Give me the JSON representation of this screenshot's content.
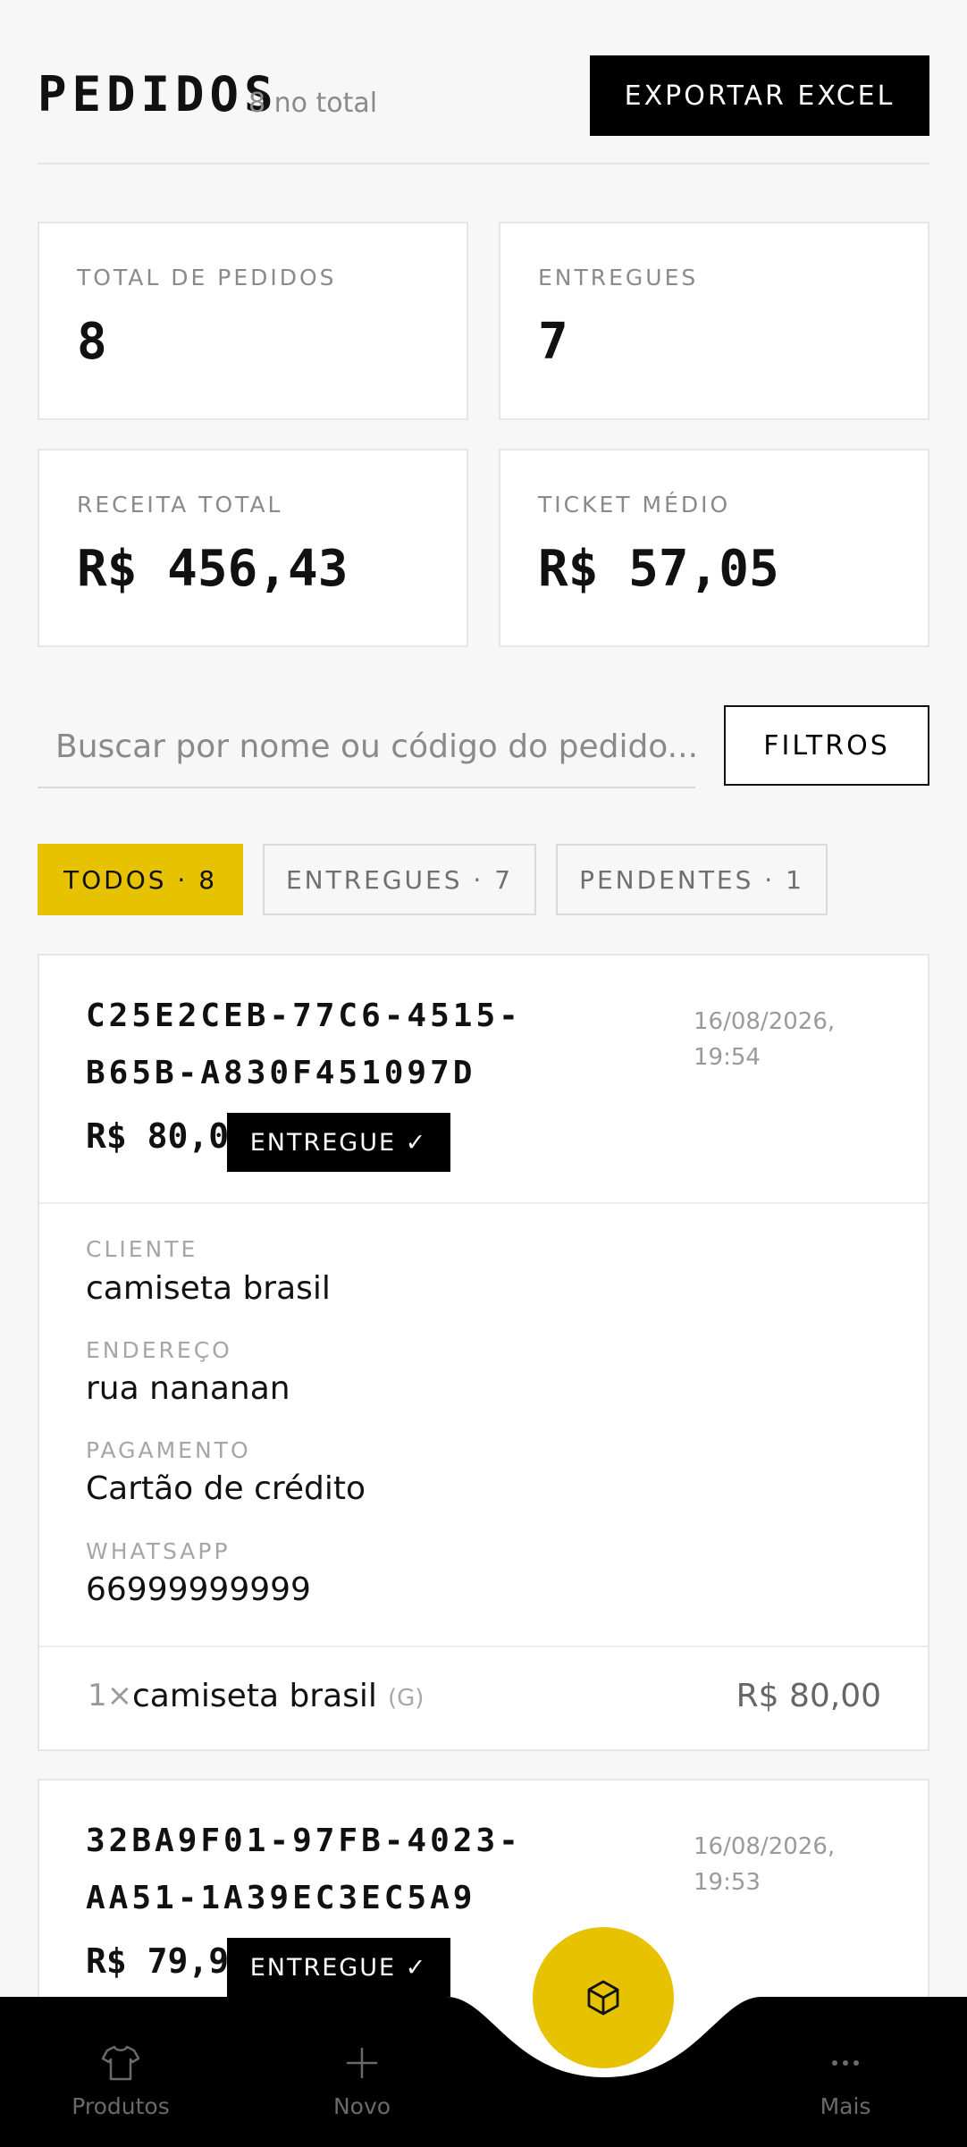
{
  "header": {
    "title": "PEDIDOS",
    "subtitle": "8 no total",
    "export_label": "EXPORTAR EXCEL"
  },
  "stats": [
    {
      "label": "TOTAL DE PEDIDOS",
      "value": "8"
    },
    {
      "label": "ENTREGUES",
      "value": "7"
    },
    {
      "label": "RECEITA TOTAL",
      "value": "R$ 456,43"
    },
    {
      "label": "TICKET MÉDIO",
      "value": "R$ 57,05"
    }
  ],
  "search": {
    "placeholder": "Buscar por nome ou código do pedido...",
    "filters_label": "FILTROS"
  },
  "tabs": [
    {
      "label": "TODOS · 8",
      "active": true
    },
    {
      "label": "ENTREGUES · 7",
      "active": false
    },
    {
      "label": "PENDENTES · 1",
      "active": false
    }
  ],
  "orders": [
    {
      "code": "C25E2CEB-77C6-4515-B65B-A830F451097D",
      "date": "16/08/2026,",
      "time": "19:54",
      "total": "R$ 80,00",
      "status": "ENTREGUE ✓",
      "client_label": "CLIENTE",
      "client": "camiseta brasil",
      "address_label": "ENDEREÇO",
      "address": "rua nananan",
      "payment_label": "PAGAMENTO",
      "payment": "Cartão de crédito",
      "whatsapp_label": "WHATSAPP",
      "whatsapp": "66999999999",
      "items": [
        {
          "qty": "1×",
          "name": "camiseta brasil",
          "size": "(G)",
          "price": "R$ 80,00"
        }
      ]
    },
    {
      "code": "32BA9F01-97FB-4023-AA51-1A39EC3EC5A9",
      "date": "16/08/2026,",
      "time": "19:53",
      "total": "R$ 79,99",
      "status": "ENTREGUE ✓"
    }
  ],
  "nav": [
    {
      "label": "Produtos",
      "icon": "shirt-icon"
    },
    {
      "label": "Novo",
      "icon": "plus-icon"
    },
    {
      "label": "Mais",
      "icon": "more-icon"
    }
  ],
  "fab_icon": "box-icon",
  "colors": {
    "accent": "#e6c200",
    "dark": "#000000",
    "background": "#f7f7f7"
  }
}
